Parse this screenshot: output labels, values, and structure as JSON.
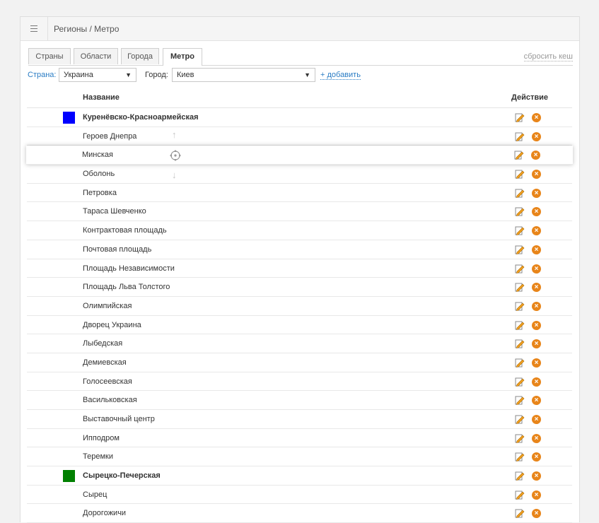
{
  "header": {
    "breadcrumb": "Регионы / Метро"
  },
  "tabs": [
    {
      "label": "Страны",
      "active": false
    },
    {
      "label": "Области",
      "active": false
    },
    {
      "label": "Города",
      "active": false
    },
    {
      "label": "Метро",
      "active": true
    }
  ],
  "reset_cache": "сбросить кеш",
  "filters": {
    "country_label": "Страна:",
    "country_value": "Украина",
    "city_label": "Город:",
    "city_value": "Киев",
    "add_label": "+ добавить"
  },
  "table": {
    "col_name": "Название",
    "col_action": "Действие",
    "rows": [
      {
        "name": "Куренёвско-Красноармейская",
        "type": "line",
        "color": "#0000ff"
      },
      {
        "name": "Героев Днепра",
        "type": "station"
      },
      {
        "name": "Минская",
        "type": "station",
        "dragging": true
      },
      {
        "name": "Оболонь",
        "type": "station"
      },
      {
        "name": "Петровка",
        "type": "station"
      },
      {
        "name": "Тараса Шевченко",
        "type": "station"
      },
      {
        "name": "Контрактовая площадь",
        "type": "station"
      },
      {
        "name": "Почтовая площадь",
        "type": "station"
      },
      {
        "name": "Площадь Независимости",
        "type": "station"
      },
      {
        "name": "Площадь Льва Толстого",
        "type": "station"
      },
      {
        "name": "Олимпийская",
        "type": "station"
      },
      {
        "name": "Дворец Украина",
        "type": "station"
      },
      {
        "name": "Лыбедская",
        "type": "station"
      },
      {
        "name": "Демиевская",
        "type": "station"
      },
      {
        "name": "Голосеевская",
        "type": "station"
      },
      {
        "name": "Васильковская",
        "type": "station"
      },
      {
        "name": "Выставочный центр",
        "type": "station"
      },
      {
        "name": "Ипподром",
        "type": "station"
      },
      {
        "name": "Теремки",
        "type": "station"
      },
      {
        "name": "Сырецко-Печерская",
        "type": "line",
        "color": "#008000"
      },
      {
        "name": "Сырец",
        "type": "station"
      },
      {
        "name": "Дорогожичи",
        "type": "station"
      }
    ]
  },
  "icons": {
    "menu": "menu-icon",
    "edit": "edit-icon",
    "delete": "delete-icon",
    "move": "move-icon",
    "up": "arrow-up-icon",
    "down": "arrow-down-icon"
  },
  "colors": {
    "accent": "#2a7cc4",
    "delete": "#e8851a"
  }
}
